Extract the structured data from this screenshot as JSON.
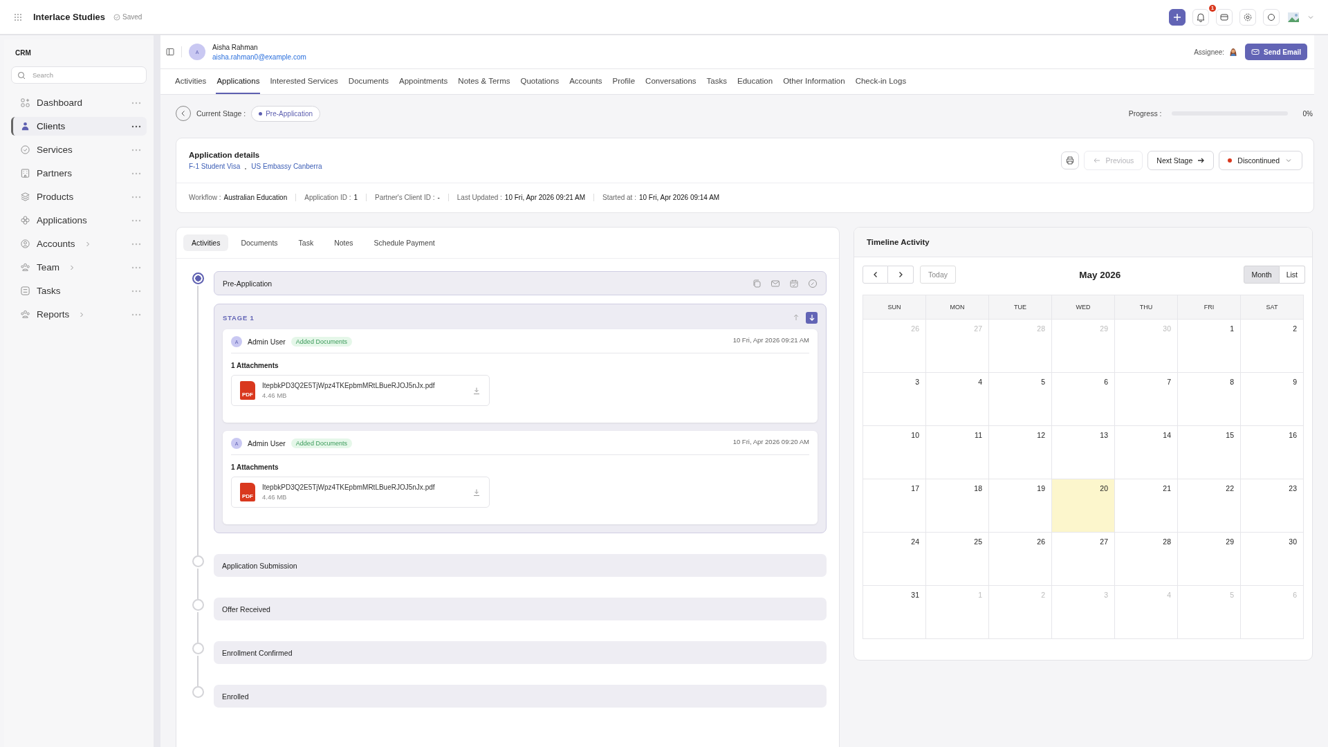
{
  "topbar": {
    "app_name": "Interlace Studies",
    "save_state": "Saved",
    "notification_count": "1"
  },
  "sidebar": {
    "section": "CRM",
    "search": {
      "placeholder": "Search"
    },
    "items": [
      {
        "label": "Dashboard",
        "selected": false,
        "expandable": false
      },
      {
        "label": "Clients",
        "selected": true,
        "expandable": false
      },
      {
        "label": "Services",
        "selected": false,
        "expandable": false
      },
      {
        "label": "Partners",
        "selected": false,
        "expandable": false
      },
      {
        "label": "Products",
        "selected": false,
        "expandable": false
      },
      {
        "label": "Applications",
        "selected": false,
        "expandable": false
      },
      {
        "label": "Accounts",
        "selected": false,
        "expandable": true
      },
      {
        "label": "Team",
        "selected": false,
        "expandable": true
      },
      {
        "label": "Tasks",
        "selected": false,
        "expandable": false
      },
      {
        "label": "Reports",
        "selected": false,
        "expandable": true
      }
    ]
  },
  "client": {
    "initial": "A",
    "name": "Aisha Rahman",
    "email": "aisha.rahman0@example.com",
    "assignee_label": "Assignee:",
    "send_email": "Send Email"
  },
  "tabs": [
    {
      "label": "Activities",
      "selected": false
    },
    {
      "label": "Applications",
      "selected": true
    },
    {
      "label": "Interested Services",
      "selected": false
    },
    {
      "label": "Documents",
      "selected": false
    },
    {
      "label": "Appointments",
      "selected": false
    },
    {
      "label": "Notes & Terms",
      "selected": false
    },
    {
      "label": "Quotations",
      "selected": false
    },
    {
      "label": "Accounts",
      "selected": false
    },
    {
      "label": "Profile",
      "selected": false
    },
    {
      "label": "Conversations",
      "selected": false
    },
    {
      "label": "Tasks",
      "selected": false
    },
    {
      "label": "Education",
      "selected": false
    },
    {
      "label": "Other Information",
      "selected": false
    },
    {
      "label": "Check-in Logs",
      "selected": false
    }
  ],
  "stage_bar": {
    "label": "Current Stage :",
    "stage": "Pre-Application",
    "progress_label": "Progress :",
    "progress": {
      "level": 0,
      "reading": "0%"
    }
  },
  "details": {
    "title": "Application details",
    "links": [
      "F-1 Student Visa",
      "US Embassy Canberra"
    ],
    "actions": {
      "previous": {
        "label": "Previous",
        "disabled": true
      },
      "next": "Next Stage",
      "status": "Discontinued"
    },
    "meta": [
      {
        "label": "Workflow :",
        "value": "Australian Education"
      },
      {
        "label": "Application ID :",
        "value": "1"
      },
      {
        "label": "Partner's Client ID :",
        "value": "-"
      },
      {
        "label": "Last Updated :",
        "value": "10 Fri, Apr 2026 09:21 AM"
      },
      {
        "label": "Started at :",
        "value": "10 Fri, Apr 2026 09:14 AM"
      }
    ]
  },
  "activity_tabs": [
    {
      "label": "Activities",
      "selected": true
    },
    {
      "label": "Documents",
      "selected": false
    },
    {
      "label": "Task",
      "selected": false
    },
    {
      "label": "Notes",
      "selected": false
    },
    {
      "label": "Schedule Payment",
      "selected": false
    }
  ],
  "stages": [
    {
      "label": "Pre-Application",
      "selected": true,
      "group": {
        "title": "STAGE 1",
        "entries": [
          {
            "initial": "A",
            "user": "Admin User",
            "tag": "Added Documents",
            "time": "10 Fri, Apr 2026 09:21 AM",
            "attachments_label": "1 Attachments",
            "files": [
              {
                "badge": "PDF",
                "name": "ItepbkPD3Q2E5TjWpz4TKEpbmMRtLBueRJOJ5nJx.pdf",
                "size": "4.46 MB"
              }
            ]
          },
          {
            "initial": "A",
            "user": "Admin User",
            "tag": "Added Documents",
            "time": "10 Fri, Apr 2026 09:20 AM",
            "attachments_label": "1 Attachments",
            "files": [
              {
                "badge": "PDF",
                "name": "ItepbkPD3Q2E5TjWpz4TKEpbmMRtLBueRJOJ5nJx.pdf",
                "size": "4.46 MB"
              }
            ]
          }
        ]
      }
    },
    {
      "label": "Application Submission",
      "selected": false
    },
    {
      "label": "Offer Received",
      "selected": false
    },
    {
      "label": "Enrollment Confirmed",
      "selected": false
    },
    {
      "label": "Enrolled",
      "selected": false
    }
  ],
  "calendar": {
    "title": "Timeline Activity",
    "today_button": "Today",
    "month": "May 2026",
    "views": [
      {
        "label": "Month",
        "selected": true
      },
      {
        "label": "List",
        "selected": false
      }
    ],
    "weekdays": [
      "SUN",
      "MON",
      "TUE",
      "WED",
      "THU",
      "FRI",
      "SAT"
    ],
    "days": [
      {
        "label": "26",
        "muted": true,
        "today": false
      },
      {
        "label": "27",
        "muted": true,
        "today": false
      },
      {
        "label": "28",
        "muted": true,
        "today": false
      },
      {
        "label": "29",
        "muted": true,
        "today": false
      },
      {
        "label": "30",
        "muted": true,
        "today": false
      },
      {
        "label": "1",
        "muted": false,
        "today": false
      },
      {
        "label": "2",
        "muted": false,
        "today": false
      },
      {
        "label": "3",
        "muted": false,
        "today": false
      },
      {
        "label": "4",
        "muted": false,
        "today": false
      },
      {
        "label": "5",
        "muted": false,
        "today": false
      },
      {
        "label": "6",
        "muted": false,
        "today": false
      },
      {
        "label": "7",
        "muted": false,
        "today": false
      },
      {
        "label": "8",
        "muted": false,
        "today": false
      },
      {
        "label": "9",
        "muted": false,
        "today": false
      },
      {
        "label": "10",
        "muted": false,
        "today": false
      },
      {
        "label": "11",
        "muted": false,
        "today": false
      },
      {
        "label": "12",
        "muted": false,
        "today": false
      },
      {
        "label": "13",
        "muted": false,
        "today": false
      },
      {
        "label": "14",
        "muted": false,
        "today": false
      },
      {
        "label": "15",
        "muted": false,
        "today": false
      },
      {
        "label": "16",
        "muted": false,
        "today": false
      },
      {
        "label": "17",
        "muted": false,
        "today": false
      },
      {
        "label": "18",
        "muted": false,
        "today": false
      },
      {
        "label": "19",
        "muted": false,
        "today": false
      },
      {
        "label": "20",
        "muted": false,
        "today": true
      },
      {
        "label": "21",
        "muted": false,
        "today": false
      },
      {
        "label": "22",
        "muted": false,
        "today": false
      },
      {
        "label": "23",
        "muted": false,
        "today": false
      },
      {
        "label": "24",
        "muted": false,
        "today": false
      },
      {
        "label": "25",
        "muted": false,
        "today": false
      },
      {
        "label": "26",
        "muted": false,
        "today": false
      },
      {
        "label": "27",
        "muted": false,
        "today": false
      },
      {
        "label": "28",
        "muted": false,
        "today": false
      },
      {
        "label": "29",
        "muted": false,
        "today": false
      },
      {
        "label": "30",
        "muted": false,
        "today": false
      },
      {
        "label": "31",
        "muted": false,
        "today": false
      },
      {
        "label": "1",
        "muted": true,
        "today": false
      },
      {
        "label": "2",
        "muted": true,
        "today": false
      },
      {
        "label": "3",
        "muted": true,
        "today": false
      },
      {
        "label": "4",
        "muted": true,
        "today": false
      },
      {
        "label": "5",
        "muted": true,
        "today": false
      },
      {
        "label": "6",
        "muted": true,
        "today": false
      }
    ]
  }
}
